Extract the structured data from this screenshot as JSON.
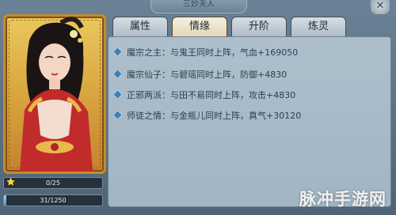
{
  "window": {
    "title": "三妙夫人"
  },
  "tabs": [
    {
      "label": "属性"
    },
    {
      "label": "情缘"
    },
    {
      "label": "升阶"
    },
    {
      "label": "炼灵"
    }
  ],
  "active_tab": "情缘",
  "fates": [
    {
      "name": "魔宗之主：",
      "desc": "与鬼王同时上阵，气血+169050"
    },
    {
      "name": "魔宗仙子：",
      "desc": "与碧瑶同时上阵，防御+4830"
    },
    {
      "name": "正邪两派：",
      "desc": "与田不易同时上阵，攻击+4830"
    },
    {
      "name": "师徒之情：",
      "desc": "与金瓶儿同时上阵，真气+30120"
    }
  ],
  "bars": {
    "level": {
      "text": "0/25",
      "fraction": 0.0
    },
    "exp": {
      "text": "31/1250",
      "fraction": 0.025
    }
  },
  "watermark": "脉冲手游网",
  "colors": {
    "accent_blue": "#3c7fb7",
    "card_gold": "#d7a23d",
    "panel_bg": "#aebfcc"
  }
}
